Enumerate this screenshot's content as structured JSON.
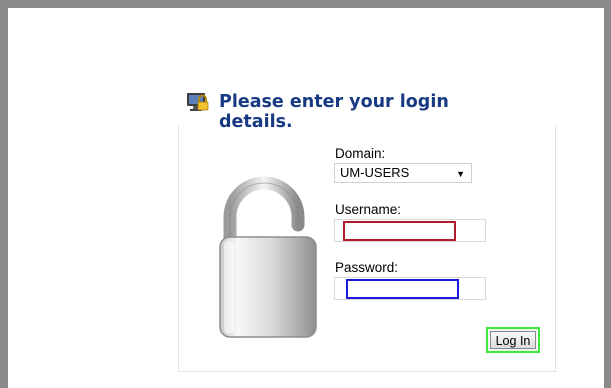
{
  "login": {
    "title": "Please enter your login details.",
    "domain_label": "Domain:",
    "domain_value": "UM-USERS",
    "username_label": "Username:",
    "username_value": "",
    "password_label": "Password:",
    "password_value": "",
    "login_button": "Log In"
  },
  "icons": {
    "header": "monitor-lock-icon",
    "main": "padlock-icon",
    "select": "chevron-down-icon"
  },
  "colors": {
    "title": "#173a83",
    "frame": "#8a8a8a",
    "username_highlight": "#b01c2e",
    "password_highlight": "#1a1ad8",
    "login_highlight": "#3ee83e"
  }
}
